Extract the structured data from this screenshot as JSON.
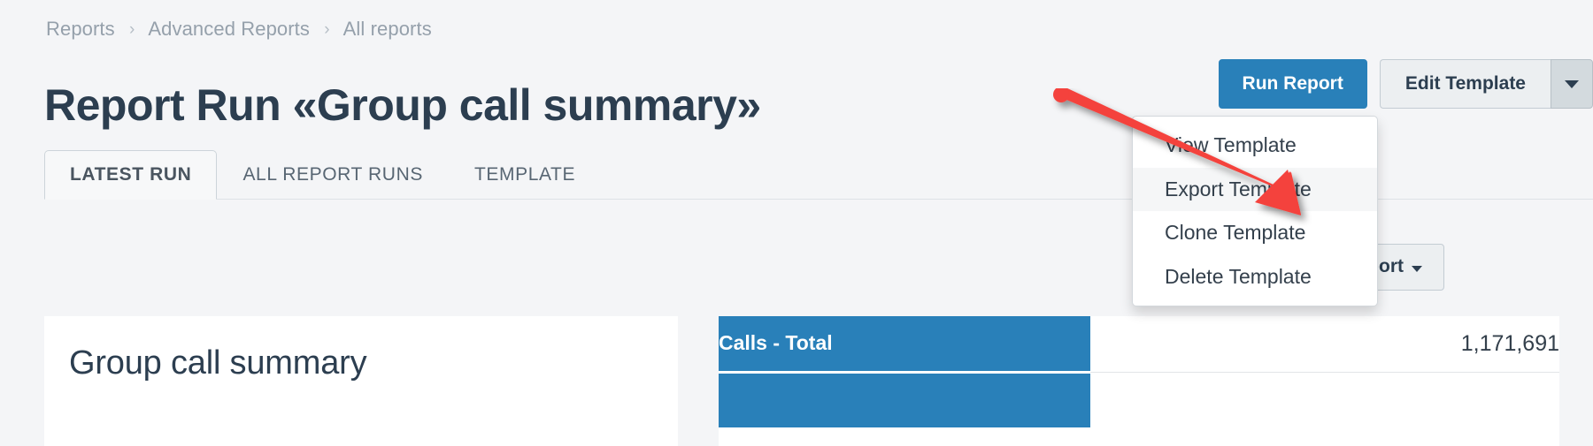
{
  "breadcrumb": {
    "items": [
      {
        "label": "Reports"
      },
      {
        "label": "Advanced Reports"
      },
      {
        "label": "All reports"
      }
    ],
    "separator": "›"
  },
  "header": {
    "title": "Report Run «Group call summary»",
    "run_report_label": "Run Report",
    "edit_template_label": "Edit Template",
    "caret_icon": "chevron-down-icon"
  },
  "tabs": [
    {
      "label": "LATEST RUN",
      "active": true
    },
    {
      "label": "ALL REPORT RUNS",
      "active": false
    },
    {
      "label": "TEMPLATE",
      "active": false
    }
  ],
  "toolbar": {
    "export_label": "Export",
    "export_caret_icon": "caret-down-icon"
  },
  "dropdown": {
    "items": [
      {
        "label": "View Template",
        "highlighted": false
      },
      {
        "label": "Export Template",
        "highlighted": true
      },
      {
        "label": "Clone Template",
        "highlighted": false
      },
      {
        "label": "Delete Template",
        "highlighted": false
      }
    ]
  },
  "report": {
    "panel_title": "Group call summary",
    "kpi_rows": [
      {
        "label": "Calls - Total",
        "value": "1,171,691"
      },
      {
        "label": "",
        "value": ""
      }
    ]
  },
  "annotation": {
    "arrow_icon": "red-arrow-annotation",
    "arrow_color": "#f4433c",
    "points_to": "Export Template"
  },
  "colors": {
    "primary": "#2980b9",
    "page_background": "#f4f5f7",
    "panel_background": "#ffffff",
    "text": "#2c3e50",
    "muted_text": "#95a0ab",
    "annotation_red": "#f4433c"
  }
}
